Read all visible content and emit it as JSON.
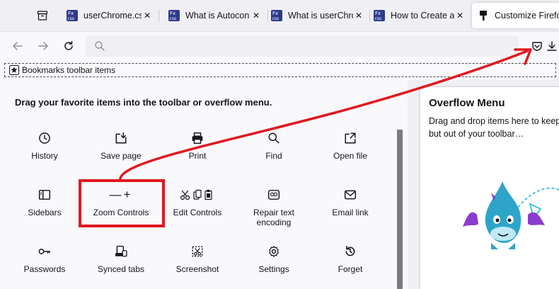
{
  "tabs": [
    {
      "label": "userChrome.css",
      "favicon": "fx-css-icon",
      "active": false
    },
    {
      "label": "What is Autocon",
      "favicon": "fx-css-icon",
      "active": false
    },
    {
      "label": "What is userChro",
      "favicon": "fx-css-icon",
      "active": false
    },
    {
      "label": "How to Create a",
      "favicon": "fx-css-icon",
      "active": false
    },
    {
      "label": "Customize Firefo",
      "favicon": "paintbrush-icon",
      "active": true
    }
  ],
  "favicon_text": {
    "line1": "Fx",
    "line2": "css"
  },
  "bookmarks": {
    "label": "Bookmarks toolbar items"
  },
  "palette": {
    "title": "Drag your favorite items into the toolbar or overflow menu.",
    "items": [
      {
        "label": "History",
        "icon": "clock-icon"
      },
      {
        "label": "Save page",
        "icon": "save-page-icon"
      },
      {
        "label": "Print",
        "icon": "printer-icon"
      },
      {
        "label": "Find",
        "icon": "magnifier-icon"
      },
      {
        "label": "Open file",
        "icon": "open-file-icon"
      },
      {
        "label": "Sidebars",
        "icon": "sidebar-icon"
      },
      {
        "label": "Zoom Controls",
        "icon": "zoom-controls-icon"
      },
      {
        "label": "Edit Controls",
        "icon": "edit-controls-icon"
      },
      {
        "label": "Repair text encoding",
        "icon": "encoding-icon"
      },
      {
        "label": "Email link",
        "icon": "envelope-icon"
      },
      {
        "label": "Passwords",
        "icon": "key-icon"
      },
      {
        "label": "Synced tabs",
        "icon": "synced-tabs-icon"
      },
      {
        "label": "Screenshot",
        "icon": "screenshot-icon"
      },
      {
        "label": "Settings",
        "icon": "gear-icon"
      },
      {
        "label": "Forget",
        "icon": "forget-icon"
      }
    ],
    "zoom_glyph": "—+"
  },
  "overflow": {
    "title": "Overflow Menu",
    "desc_line1": "Drag and drop items here to keep",
    "desc_line2": "but out of your toolbar…"
  },
  "colors": {
    "annotation": "#e0191f",
    "accent_dragon": "#2fa4c9"
  }
}
